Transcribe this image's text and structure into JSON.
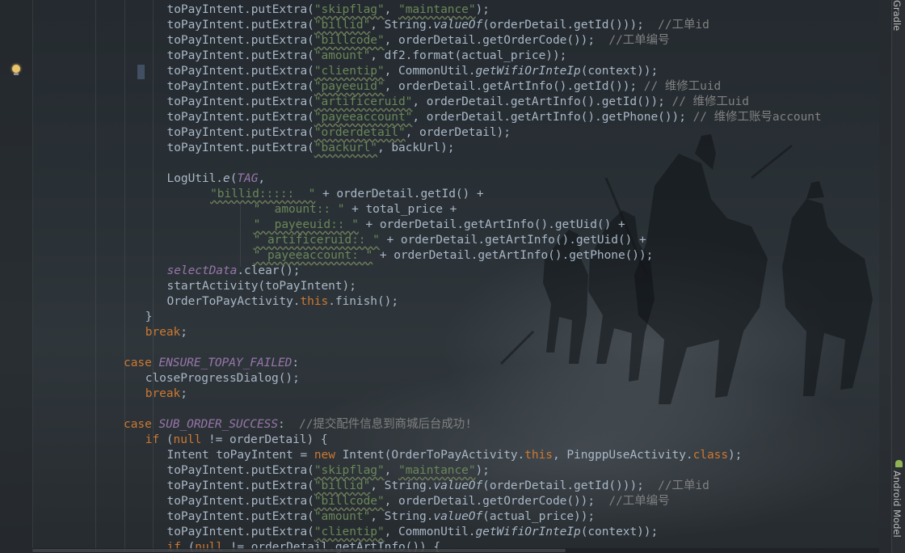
{
  "editor": {
    "language": "java",
    "lines": [
      {
        "indent": 18,
        "tokens": [
          [
            "def",
            "toPayIntent.putExtra("
          ],
          [
            "str-u",
            "\"skipflag\""
          ],
          [
            "def",
            ", "
          ],
          [
            "str-u",
            "\"maintance\""
          ],
          [
            "def",
            ");"
          ]
        ]
      },
      {
        "indent": 18,
        "tokens": [
          [
            "def",
            "toPayIntent.putExtra("
          ],
          [
            "str-u",
            "\"billid\""
          ],
          [
            "def",
            ", String."
          ],
          [
            "it",
            "valueOf"
          ],
          [
            "def",
            "(orderDetail.getId()));  "
          ],
          [
            "cmt",
            "//工单id"
          ]
        ]
      },
      {
        "indent": 18,
        "tokens": [
          [
            "def",
            "toPayIntent.putExtra("
          ],
          [
            "str-u",
            "\"billcode\""
          ],
          [
            "def",
            ", orderDetail.getOrderCode());  "
          ],
          [
            "cmt",
            "//工单编号"
          ]
        ]
      },
      {
        "indent": 18,
        "tokens": [
          [
            "def",
            "toPayIntent.putExtra("
          ],
          [
            "str",
            "\"amount\""
          ],
          [
            "def",
            ", df2.format(actual_price));"
          ]
        ]
      },
      {
        "indent": 18,
        "tokens": [
          [
            "def",
            "toPayIntent.putExtra("
          ],
          [
            "str-u",
            "\"clientip\""
          ],
          [
            "def",
            ", CommonUtil."
          ],
          [
            "it",
            "getWifiOrInteIp"
          ],
          [
            "def",
            "(context));"
          ]
        ]
      },
      {
        "indent": 18,
        "tokens": [
          [
            "def",
            "toPayIntent.putExtra("
          ],
          [
            "str-u",
            "\"payeeuid\""
          ],
          [
            "def",
            ", orderDetail.getArtInfo().getId()); "
          ],
          [
            "cmt",
            "// 维修工uid"
          ]
        ]
      },
      {
        "indent": 18,
        "tokens": [
          [
            "def",
            "toPayIntent.putExtra("
          ],
          [
            "str-u",
            "\"artificeruid\""
          ],
          [
            "def",
            ", orderDetail.getArtInfo().getId()); "
          ],
          [
            "cmt",
            "// 维修工uid"
          ]
        ]
      },
      {
        "indent": 18,
        "tokens": [
          [
            "def",
            "toPayIntent.putExtra("
          ],
          [
            "str-u",
            "\"payeeaccount\""
          ],
          [
            "def",
            ", orderDetail.getArtInfo().getPhone()); "
          ],
          [
            "cmt",
            "// 维修工账号account"
          ]
        ]
      },
      {
        "indent": 18,
        "tokens": [
          [
            "def",
            "toPayIntent.putExtra("
          ],
          [
            "str-u",
            "\"orderdetail\""
          ],
          [
            "def",
            ", orderDetail);"
          ]
        ]
      },
      {
        "indent": 18,
        "tokens": [
          [
            "def",
            "toPayIntent.putExtra("
          ],
          [
            "str-u",
            "\"backurl\""
          ],
          [
            "def",
            ", backUrl);"
          ]
        ]
      },
      {
        "indent": 18,
        "tokens": []
      },
      {
        "indent": 18,
        "tokens": [
          [
            "def",
            "LogUtil."
          ],
          [
            "it",
            "e"
          ],
          [
            "def",
            "("
          ],
          [
            "fit",
            "TAG"
          ],
          [
            "def",
            ","
          ]
        ]
      },
      {
        "indent": 24,
        "tokens": [
          [
            "str-u",
            "\"billid:::::  \""
          ],
          [
            "def",
            " + orderDetail.getId() +"
          ]
        ]
      },
      {
        "indent": 30,
        "tokens": [
          [
            "str",
            "\"  amount:: \""
          ],
          [
            "def",
            " + total_price +"
          ]
        ]
      },
      {
        "indent": 30,
        "tokens": [
          [
            "str-u",
            "\"  payeeuid:: \""
          ],
          [
            "def",
            " + orderDetail.getArtInfo().getUid() +"
          ]
        ]
      },
      {
        "indent": 30,
        "tokens": [
          [
            "str-u",
            "\" artificeruid:: \""
          ],
          [
            "def",
            " + orderDetail.getArtInfo().getUid() +"
          ]
        ]
      },
      {
        "indent": 30,
        "tokens": [
          [
            "str-u",
            "\" payeeaccount: \""
          ],
          [
            "def",
            " + orderDetail.getArtInfo().getPhone());"
          ]
        ]
      },
      {
        "indent": 18,
        "tokens": [
          [
            "fit",
            "selectData"
          ],
          [
            "def",
            ".clear();"
          ]
        ]
      },
      {
        "indent": 18,
        "tokens": [
          [
            "def",
            "startActivity(toPayIntent);"
          ]
        ]
      },
      {
        "indent": 18,
        "tokens": [
          [
            "def",
            "OrderToPayActivity."
          ],
          [
            "kw",
            "this"
          ],
          [
            "def",
            ".finish();"
          ]
        ]
      },
      {
        "indent": 15,
        "tokens": [
          [
            "def",
            "}"
          ]
        ]
      },
      {
        "indent": 15,
        "tokens": [
          [
            "kw",
            "break"
          ],
          [
            "def",
            ";"
          ]
        ]
      },
      {
        "indent": 12,
        "tokens": []
      },
      {
        "indent": 12,
        "tokens": [
          [
            "kw",
            "case "
          ],
          [
            "fit",
            "ENSURE_TOPAY_FAILED"
          ],
          [
            "def",
            ":"
          ]
        ]
      },
      {
        "indent": 15,
        "tokens": [
          [
            "def",
            "closeProgressDialog();"
          ]
        ]
      },
      {
        "indent": 15,
        "tokens": [
          [
            "kw",
            "break"
          ],
          [
            "def",
            ";"
          ]
        ]
      },
      {
        "indent": 12,
        "tokens": []
      },
      {
        "indent": 12,
        "tokens": [
          [
            "kw",
            "case "
          ],
          [
            "fit",
            "SUB_ORDER_SUCCESS"
          ],
          [
            "def",
            ":  "
          ],
          [
            "cmt",
            "//提交配件信息到商城后台成功!"
          ]
        ]
      },
      {
        "indent": 15,
        "tokens": [
          [
            "kw",
            "if "
          ],
          [
            "def",
            "("
          ],
          [
            "kw",
            "null "
          ],
          [
            "def",
            "!= orderDetail) {"
          ]
        ]
      },
      {
        "indent": 18,
        "tokens": [
          [
            "def",
            "Intent toPayIntent = "
          ],
          [
            "kw",
            "new "
          ],
          [
            "def",
            "Intent(OrderToPayActivity."
          ],
          [
            "kw",
            "this"
          ],
          [
            "def",
            ", PingppUseActivity."
          ],
          [
            "kw",
            "class"
          ],
          [
            "def",
            ");"
          ]
        ]
      },
      {
        "indent": 18,
        "tokens": [
          [
            "def",
            "toPayIntent.putExtra("
          ],
          [
            "str-u",
            "\"skipflag\""
          ],
          [
            "def",
            ", "
          ],
          [
            "str-u",
            "\"maintance\""
          ],
          [
            "def",
            ");"
          ]
        ]
      },
      {
        "indent": 18,
        "tokens": [
          [
            "def",
            "toPayIntent.putExtra("
          ],
          [
            "str-u",
            "\"billid\""
          ],
          [
            "def",
            ", String."
          ],
          [
            "it",
            "valueOf"
          ],
          [
            "def",
            "(orderDetail.getId()));  "
          ],
          [
            "cmt",
            "//工单id"
          ]
        ]
      },
      {
        "indent": 18,
        "tokens": [
          [
            "def",
            "toPayIntent.putExtra("
          ],
          [
            "str-u",
            "\"billcode\""
          ],
          [
            "def",
            ", orderDetail.getOrderCode());  "
          ],
          [
            "cmt",
            "//工单编号"
          ]
        ]
      },
      {
        "indent": 18,
        "tokens": [
          [
            "def",
            "toPayIntent.putExtra("
          ],
          [
            "str",
            "\"amount\""
          ],
          [
            "def",
            ", String."
          ],
          [
            "it",
            "valueOf"
          ],
          [
            "def",
            "(actual_price));"
          ]
        ]
      },
      {
        "indent": 18,
        "tokens": [
          [
            "def",
            "toPayIntent.putExtra("
          ],
          [
            "str-u",
            "\"clientip\""
          ],
          [
            "def",
            ", CommonUtil."
          ],
          [
            "it",
            "getWifiOrInteIp"
          ],
          [
            "def",
            "(context));"
          ]
        ]
      },
      {
        "indent": 18,
        "tokens": [
          [
            "kw",
            "if "
          ],
          [
            "def",
            "("
          ],
          [
            "kw",
            "null "
          ],
          [
            "def",
            "!= orderDetail.getArtInfo()) {"
          ]
        ]
      }
    ]
  },
  "sidebar_tabs": {
    "gradle": "Gradle",
    "android_model": "Android Model"
  },
  "colors": {
    "keyword": "#cc7832",
    "string": "#6a8759",
    "field": "#9876aa",
    "comment": "#808080",
    "text": "#a9b7c6"
  },
  "icons": {
    "gutter": "lightbulb-icon",
    "android_tab": "android-icon"
  }
}
